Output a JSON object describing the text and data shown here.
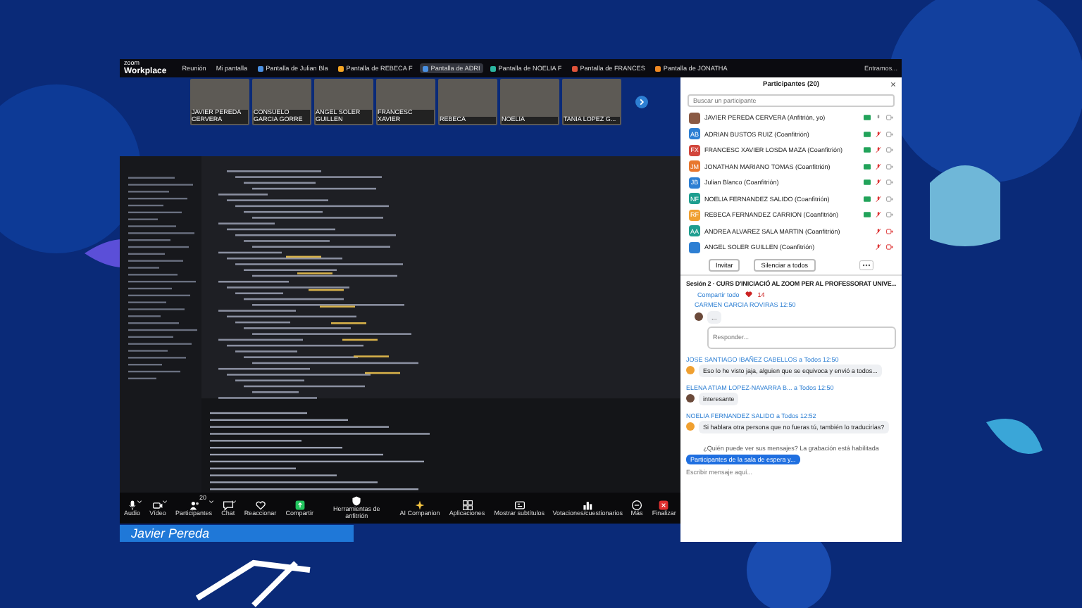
{
  "topbar": {
    "logo_small": "zoom",
    "logo": "Workplace",
    "meeting": "Reunión",
    "my_screen": "Mi pantalla",
    "tabs": [
      {
        "label": "Pantalla de Julian Bla",
        "color": "#4a90e2",
        "selected": false
      },
      {
        "label": "Pantalla de REBECA F",
        "color": "#f5a623",
        "selected": false
      },
      {
        "label": "Pantalla de ADRI",
        "color": "#4a90e2",
        "selected": true
      },
      {
        "label": "Pantalla de NOELIA F",
        "color": "#2bb5a0",
        "selected": false
      },
      {
        "label": "Pantalla de FRANCES",
        "color": "#e0533a",
        "selected": false
      },
      {
        "label": "Pantalla de JONATHA",
        "color": "#f08a24",
        "selected": false
      }
    ],
    "right_text": "Entramos..."
  },
  "video_strip": [
    {
      "name": "JAVIER PEREDA CERVERA"
    },
    {
      "name": "CONSUELO GARCIA GORRE"
    },
    {
      "name": "ANGEL SOLER GUILLEN"
    },
    {
      "name": "FRANCESC XAVIER"
    },
    {
      "name": "REBECA"
    },
    {
      "name": "NOELIA"
    },
    {
      "name": "TANIA LOPEZ G..."
    }
  ],
  "toolbar": [
    {
      "label": "Audio",
      "kind": "mic",
      "caret": true
    },
    {
      "label": "Vídeo",
      "kind": "camera",
      "caret": true
    },
    {
      "label": "Participantes",
      "kind": "people",
      "caret": true,
      "count": "20"
    },
    {
      "label": "Chat",
      "kind": "chat",
      "caret": true
    },
    {
      "label": "Reaccionar",
      "kind": "heart",
      "caret": false
    },
    {
      "label": "Compartir",
      "kind": "share",
      "caret": false
    },
    {
      "label": "Herramientas de anfitrión",
      "kind": "shield",
      "caret": false
    },
    {
      "label": "AI Companion",
      "kind": "sparkle",
      "caret": false
    },
    {
      "label": "Aplicaciones",
      "kind": "apps",
      "caret": false
    },
    {
      "label": "Mostrar subtítulos",
      "kind": "cc",
      "caret": false
    },
    {
      "label": "Votaciones/cuestionarios",
      "kind": "poll",
      "caret": false
    },
    {
      "label": "Más",
      "kind": "more",
      "caret": false
    },
    {
      "label": "Finalizar",
      "kind": "end",
      "caret": false
    }
  ],
  "name_banner": "Javier Pereda",
  "participants": {
    "title": "Participantes (20)",
    "search": {
      "placeholder": "Buscar un participante"
    },
    "items": [
      {
        "name": "JAVIER PEREDA CERVERA (Anfitrión, yo)",
        "color": "#8a5a44",
        "video": true,
        "muted": false
      },
      {
        "name": "ADRIAN BUSTOS RUIZ (Coanfitrión)",
        "initials": "AB",
        "color": "#2d7fd3",
        "video": true,
        "muted": true
      },
      {
        "name": "FRANCESC XAVIER LOSDA MAZA (Coanfitrión)",
        "initials": "FX",
        "color": "#d2463c",
        "video": true,
        "muted": true
      },
      {
        "name": "JONATHAN MARIANO TOMAS (Coanfitrión)",
        "initials": "JM",
        "color": "#e8772e",
        "video": true,
        "muted": true
      },
      {
        "name": "Julian Blanco (Coanfitrión)",
        "initials": "JB",
        "color": "#2d7fd3",
        "video": true,
        "muted": true
      },
      {
        "name": "NOELIA FERNANDEZ SALIDO (Coanfitrión)",
        "initials": "NF",
        "color": "#1e9e8f",
        "video": true,
        "muted": true
      },
      {
        "name": "REBECA FERNANDEZ CARRION (Coanfitrión)",
        "initials": "RF",
        "color": "#f0a030",
        "video": true,
        "muted": true
      },
      {
        "name": "ANDREA ALVAREZ SALA MARTIN (Coanfitrión)",
        "initials": "AA",
        "color": "#1e9e8f",
        "video": false,
        "muted": true
      },
      {
        "name": "ANGEL SOLER GUILLEN (Coanfitrión)",
        "color": "#2d7fd3",
        "video": false,
        "muted": true
      }
    ],
    "buttons": [
      "Invitar",
      "Silenciar a todos"
    ]
  },
  "chat": {
    "title": "Sesión 2 · CURS D'INICIACIÓ AL ZOOM PER AL PROFESSORAT UNIVE...",
    "share": "Compartir todo",
    "reaction": "14",
    "thread": {
      "sender": "CARMEN GARCIA ROVIRAS",
      "time": "12:50",
      "text": "...",
      "reply": {
        "placeholder": "Responder..."
      }
    },
    "messages": [
      {
        "sender": "JOSE SANTIAGO IBAÑEZ CABELLOS",
        "to": "a Todos",
        "time": "12:50",
        "text": "Eso lo he visto jaja, alguien que se equivoca y envió a todos...",
        "color": "#f0a030"
      },
      {
        "sender": "ELENA ATIAM LOPEZ-NAVARRA B...",
        "to": "a Todos",
        "time": "12:50",
        "text": "interesante",
        "color": "#6b4a3a"
      },
      {
        "sender": "NOELIA FERNANDEZ SALIDO",
        "to": "a Todos",
        "time": "12:52",
        "text": "Si hablara otra persona que no fueras tú, también lo traducirías?",
        "color": "#f0a030"
      }
    ],
    "notice": "¿Quién puede ver sus mensajes? La grabación está habilitada",
    "recipient": "Participantes de la sala de espera y...",
    "input": {
      "placeholder": "Escribir mensaje aquí..."
    }
  }
}
